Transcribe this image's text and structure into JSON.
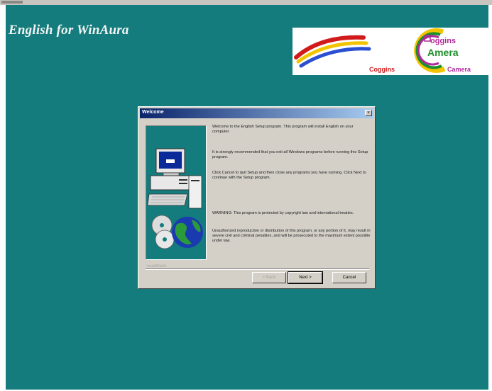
{
  "app": {
    "title": "English for WinAura"
  },
  "logo": {
    "text_top": "oggins",
    "text_middle": "Amera",
    "text_left": "Coggins",
    "text_right": "Camera"
  },
  "dialog": {
    "title": "Welcome",
    "close_glyph": "×",
    "paragraphs": [
      "Welcome to the English Setup program.  This program will install English on your computer.",
      "It is strongly recommended that you exit all Windows programs before running this Setup program.",
      "Click Cancel to quit Setup and then close any programs you have running.  Click Next to continue with the Setup program.",
      "WARNING:  This program is protected by copyright law and international treaties.",
      "Unauthorized reproduction or distribution of this program, or any portion of it, may result in severe civil and criminal penalties, and will be prosecuted to the maximum extent possible under law."
    ],
    "footer_label": "InstallShield",
    "buttons": {
      "back": "< Back",
      "next": "Next >",
      "cancel": "Cancel"
    }
  },
  "colors": {
    "desktop": "#147c7c",
    "dialog_face": "#d4d0c8",
    "titlebar_start": "#0a246a",
    "titlebar_end": "#a6caf0"
  },
  "icons": [
    "computer-icon",
    "cd-disc-icon",
    "globe-icon",
    "close-icon",
    "rainbow-swoosh-icon"
  ]
}
